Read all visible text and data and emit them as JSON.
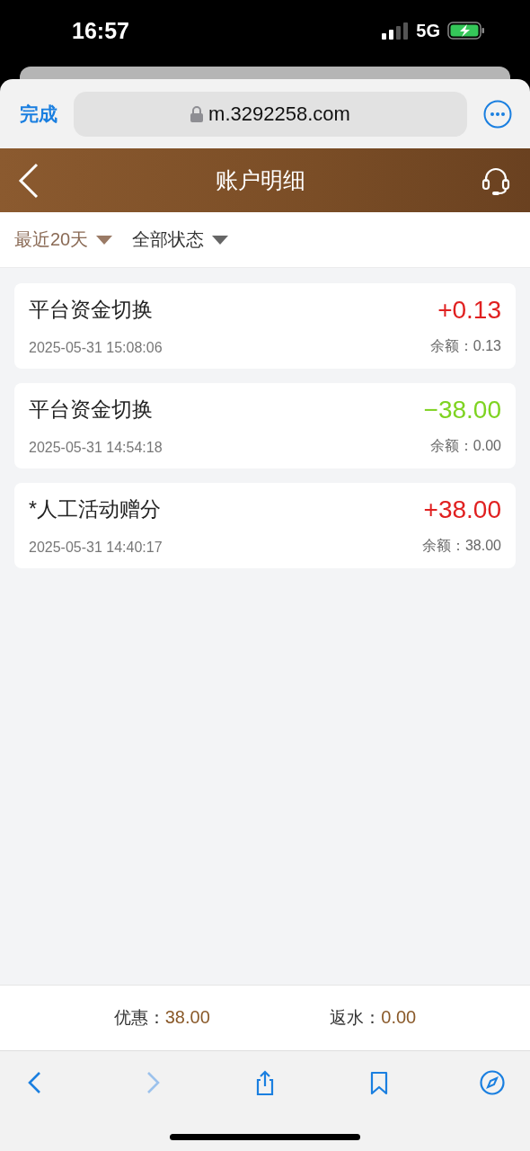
{
  "status_bar": {
    "time": "16:57",
    "network": "5G"
  },
  "browser": {
    "done": "完成",
    "url": "m.3292258.com"
  },
  "header": {
    "title": "账户明细"
  },
  "filters": [
    {
      "label": "最近20天",
      "selected": true
    },
    {
      "label": "全部状态",
      "selected": false
    }
  ],
  "records": [
    {
      "title": "平台资金切换",
      "time": "2025-05-31 15:08:06",
      "amount": "+0.13",
      "color": "#e02020",
      "balance": "余额：0.13"
    },
    {
      "title": "平台资金切换",
      "time": "2025-05-31 14:54:18",
      "amount": "−38.00",
      "color": "#7ed321",
      "balance": "余额：0.00"
    },
    {
      "title": "*人工活动赠分",
      "time": "2025-05-31 14:40:17",
      "amount": "+38.00",
      "color": "#e02020",
      "balance": "余额：38.00"
    }
  ],
  "summary": [
    {
      "label": "优惠：",
      "value": "38.00"
    },
    {
      "label": "返水：",
      "value": "0.00"
    }
  ],
  "toolbar": [
    {
      "kind": "back",
      "disabled": false
    },
    {
      "kind": "forward",
      "disabled": true
    },
    {
      "kind": "share",
      "disabled": false
    },
    {
      "kind": "bookmarks",
      "disabled": false
    },
    {
      "kind": "compass",
      "disabled": false
    }
  ]
}
